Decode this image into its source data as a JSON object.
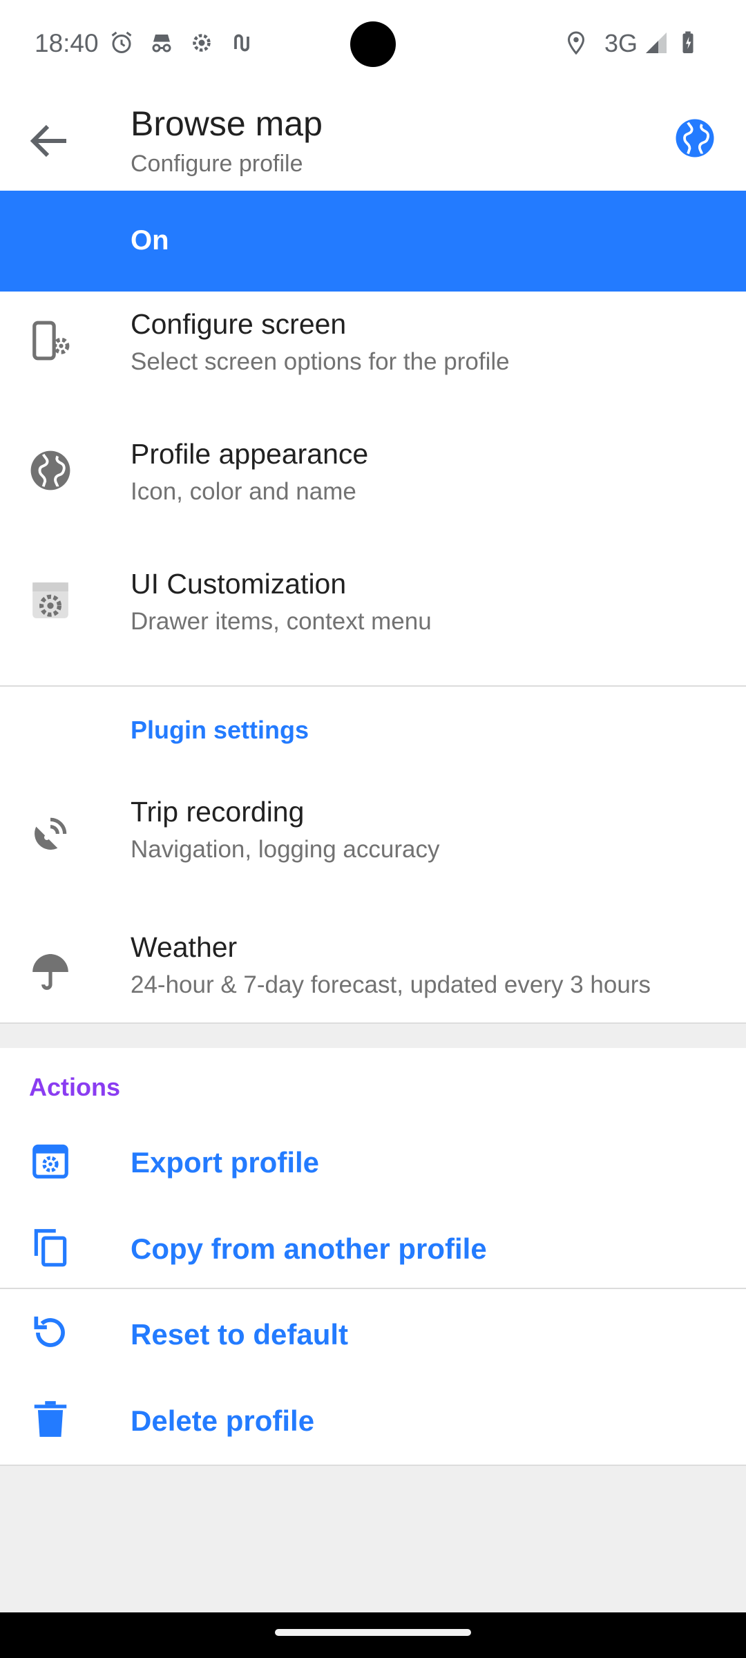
{
  "status_bar": {
    "time": "18:40",
    "network": "3G",
    "left_icons": [
      "alarm-icon",
      "incognito-icon",
      "settings-gear-icon",
      "link-icon"
    ],
    "right_icons": [
      "location-icon",
      "signal-icon",
      "battery-icon"
    ]
  },
  "app_bar": {
    "title": "Browse map",
    "subtitle": "Configure profile",
    "back_icon": "arrow-back-icon",
    "profile_icon": "globe-icon"
  },
  "profile_toggle": {
    "label": "On",
    "color": "#237bff"
  },
  "settings": {
    "items": [
      {
        "title": "Configure screen",
        "description": "Select screen options for the profile",
        "icon": "phone-settings-icon"
      },
      {
        "title": "Profile appearance",
        "description": "Icon, color and name",
        "icon": "globe-icon"
      },
      {
        "title": "UI Customization",
        "description": "Drawer items, context menu",
        "icon": "ui-settings-icon"
      }
    ]
  },
  "plugin_settings": {
    "header": "Plugin settings",
    "items": [
      {
        "title": "Trip recording",
        "description": "Navigation, logging accuracy",
        "icon": "satellite-icon"
      },
      {
        "title": "Weather",
        "description": "24-hour & 7-day forecast, updated every 3 hours",
        "icon": "umbrella-icon"
      }
    ]
  },
  "actions": {
    "header": "Actions",
    "items": [
      {
        "label": "Export profile",
        "icon": "export-profile-icon"
      },
      {
        "label": "Copy from another profile",
        "icon": "copy-icon"
      },
      {
        "label": "Reset to default",
        "icon": "reset-icon"
      },
      {
        "label": "Delete profile",
        "icon": "trash-icon"
      }
    ]
  },
  "colors": {
    "accent": "#237bff",
    "actions_header": "#8a3cf1",
    "background": "#efefef"
  }
}
